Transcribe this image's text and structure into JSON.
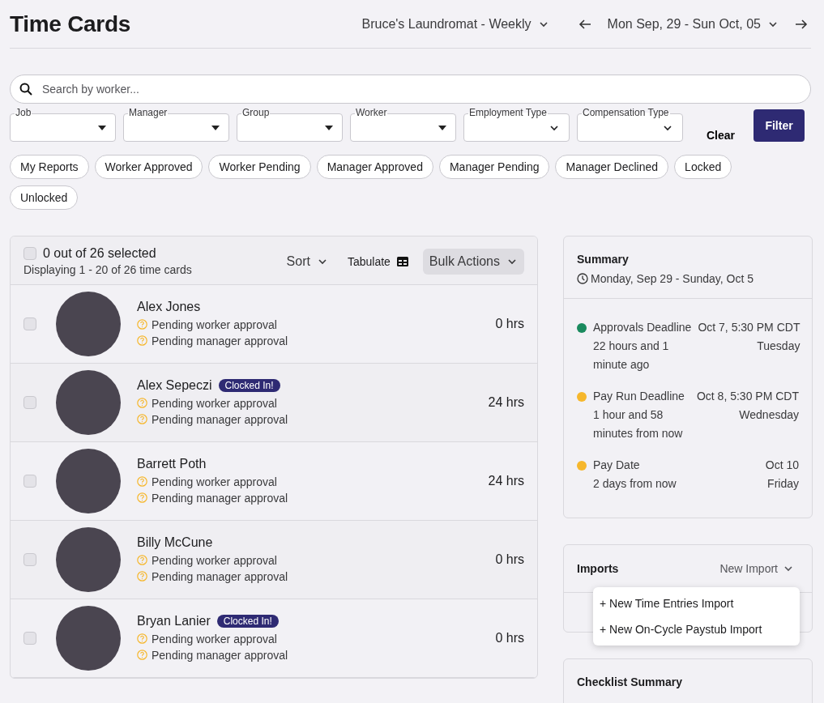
{
  "header": {
    "title": "Time Cards",
    "pay_schedule": "Bruce's Laundromat - Weekly",
    "date_range": "Mon Sep, 29 - Sun Oct, 05"
  },
  "search": {
    "placeholder": "Search by worker..."
  },
  "filters": [
    {
      "label": "Job",
      "kind": "single"
    },
    {
      "label": "Manager",
      "kind": "single"
    },
    {
      "label": "Group",
      "kind": "single"
    },
    {
      "label": "Worker",
      "kind": "single"
    },
    {
      "label": "Employment Type",
      "kind": "multi"
    },
    {
      "label": "Compensation Type",
      "kind": "multi"
    }
  ],
  "clear_button": "Clear",
  "filter_button": "Filter",
  "quick_filters": [
    {
      "label": "My Reports",
      "selected": false
    },
    {
      "label": "Worker Approved",
      "selected": false
    },
    {
      "label": "Worker Pending",
      "selected": false
    },
    {
      "label": "Manager Approved",
      "selected": false
    },
    {
      "label": "Manager Pending",
      "selected": false
    },
    {
      "label": "Manager Declined",
      "selected": false
    },
    {
      "label": "Locked",
      "selected": false
    },
    {
      "label": "Unlocked",
      "selected": false
    }
  ],
  "list": {
    "select_all_checked": false,
    "selected_count": "0 out of 26 selected",
    "displaying": "Displaying 1 - 20 of 26 time cards",
    "sort": "Sort",
    "tabulate": "Tabulate",
    "bulk_actions": "Bulk Actions",
    "rows": [
      {
        "name": "Alex Jones",
        "badge": "",
        "checked": false,
        "statuses": [
          "Pending worker approval",
          "Pending manager approval"
        ],
        "hours": "0 hrs"
      },
      {
        "name": "Alex Sepeczi",
        "badge": "Clocked In!",
        "checked": false,
        "statuses": [
          "Pending worker approval",
          "Pending manager approval"
        ],
        "hours": "24 hrs"
      },
      {
        "name": "Barrett Poth",
        "badge": "",
        "checked": false,
        "statuses": [
          "Pending worker approval",
          "Pending manager approval"
        ],
        "hours": "24 hrs"
      },
      {
        "name": "Billy McCune",
        "badge": "",
        "checked": false,
        "statuses": [
          "Pending worker approval",
          "Pending manager approval"
        ],
        "hours": "0 hrs"
      },
      {
        "name": "Bryan Lanier",
        "badge": "Clocked In!",
        "checked": false,
        "statuses": [
          "Pending worker approval",
          "Pending manager approval"
        ],
        "hours": "0 hrs"
      }
    ]
  },
  "summary": {
    "title": "Summary",
    "range": "Monday, Sep 29 - Sunday, Oct 5",
    "deadlines": [
      {
        "label": "Approvals Deadline",
        "relative": "22 hours and 1 minute ago",
        "date": "Oct 7, 5:30 PM CDT",
        "weekday": "Tuesday",
        "color": "#1a8a5e"
      },
      {
        "label": "Pay Run Deadline",
        "relative": "1 hour and 58 minutes from now",
        "date": "Oct 8, 5:30 PM CDT",
        "weekday": "Wednesday",
        "color": "#f6b72c"
      },
      {
        "label": "Pay Date",
        "relative": "2 days from now",
        "date": "Oct 10",
        "weekday": "Friday",
        "color": "#f6b72c"
      }
    ]
  },
  "imports": {
    "title": "Imports",
    "new_import": "New Import",
    "expanded": true,
    "menu": [
      "+ New Time Entries Import",
      "+ New On-Cycle Paystub Import"
    ]
  },
  "checklist": {
    "title": "Checklist Summary"
  }
}
